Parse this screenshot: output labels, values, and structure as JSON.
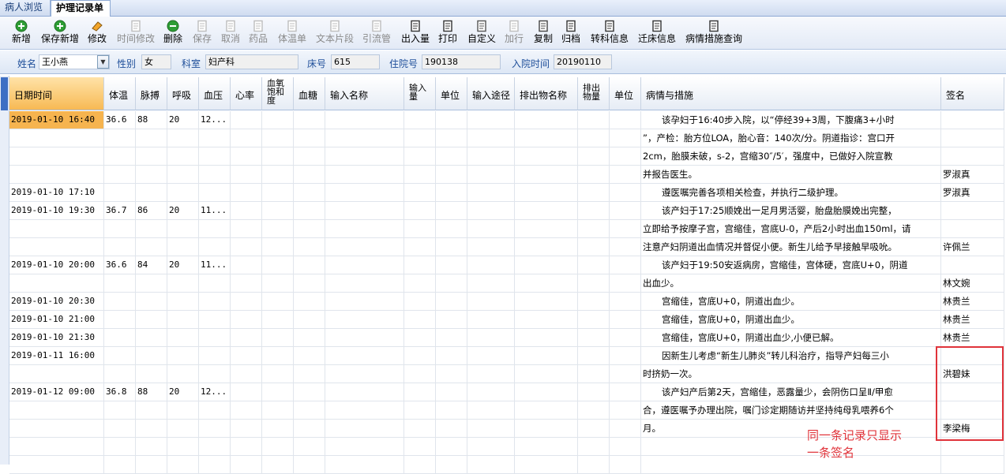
{
  "tabs": [
    "病人浏览",
    "护理记录单"
  ],
  "toolbar": [
    {
      "label": "新增",
      "icon": "add-green-icon",
      "enabled": true
    },
    {
      "label": "保存新增",
      "icon": "save-add-green-icon",
      "enabled": true
    },
    {
      "label": "修改",
      "icon": "eraser-icon",
      "enabled": true
    },
    {
      "label": "时间修改",
      "icon": "clock-edit-icon",
      "enabled": false
    },
    {
      "label": "删除",
      "icon": "delete-green-icon",
      "enabled": true
    },
    {
      "label": "保存",
      "icon": "save-disk-icon",
      "enabled": false
    },
    {
      "label": "取消",
      "icon": "undo-icon",
      "enabled": false
    },
    {
      "label": "药品",
      "icon": "medicine-icon",
      "enabled": false
    },
    {
      "label": "体温单",
      "icon": "temperature-sheet-icon",
      "enabled": false
    },
    {
      "label": "文本片段",
      "icon": "text-snippet-icon",
      "enabled": false
    },
    {
      "label": "引流管",
      "icon": "drain-tube-icon",
      "enabled": false
    },
    {
      "label": "出入量",
      "icon": "io-volume-icon",
      "enabled": true
    },
    {
      "label": "打印",
      "icon": "printer-icon",
      "enabled": true
    },
    {
      "label": "自定义",
      "icon": "custom-doc-icon",
      "enabled": true
    },
    {
      "label": "加行",
      "icon": "add-row-icon",
      "enabled": false
    },
    {
      "label": "复制",
      "icon": "copy-icon",
      "enabled": true
    },
    {
      "label": "归档",
      "icon": "archive-icon",
      "enabled": true
    },
    {
      "label": "转科信息",
      "icon": "transfer-dept-icon",
      "enabled": true
    },
    {
      "label": "迁床信息",
      "icon": "move-bed-icon",
      "enabled": true
    },
    {
      "label": "病情措施查询",
      "icon": "query-icon",
      "enabled": true
    }
  ],
  "patient": {
    "name_label": "姓名",
    "name": "王小燕",
    "gender_label": "性别",
    "gender": "女",
    "dept_label": "科室",
    "dept": "妇产科",
    "bed_label": "床号",
    "bed": "615",
    "admission_no_label": "住院号",
    "admission_no": "190138",
    "admit_time_label": "入院时间",
    "admit_time": "20190110"
  },
  "table": {
    "headers": [
      "日期时间",
      "体温",
      "脉搏",
      "呼吸",
      "血压",
      "心率",
      "血氧饱和度",
      "血糖",
      "输入名称",
      "输入量",
      "单位",
      "输入途径",
      "排出物名称",
      "排出物量",
      "单位",
      "病情与措施",
      "签名"
    ],
    "rows": [
      {
        "datetime": "2019-01-10 16:40",
        "temp": "36.6",
        "pulse": "88",
        "resp": "20",
        "bp": "12...",
        "condition": "该孕妇于16:40步入院，以“停经39+3周，下腹痛3+小时",
        "sign": ""
      },
      {
        "datetime": "",
        "temp": "",
        "pulse": "",
        "resp": "",
        "bp": "",
        "condition": "”，产检：胎方位LOA，胎心音：140次/分。阴道指诊：宫口开",
        "sign": ""
      },
      {
        "datetime": "",
        "temp": "",
        "pulse": "",
        "resp": "",
        "bp": "",
        "condition": "2cm，胎膜未破，s-2，宫缩30″/5′，强度中，已做好入院宣教",
        "sign": ""
      },
      {
        "datetime": "",
        "temp": "",
        "pulse": "",
        "resp": "",
        "bp": "",
        "condition": "并报告医生。",
        "sign": "罗淑真"
      },
      {
        "datetime": "2019-01-10 17:10",
        "temp": "",
        "pulse": "",
        "resp": "",
        "bp": "",
        "condition": "遵医嘱完善各项相关检查，并执行二级护理。",
        "sign": "罗淑真"
      },
      {
        "datetime": "2019-01-10 19:30",
        "temp": "36.7",
        "pulse": "86",
        "resp": "20",
        "bp": "11...",
        "condition": "该产妇于17:25顺娩出一足月男活婴，胎盘胎膜娩出完整，",
        "sign": ""
      },
      {
        "datetime": "",
        "temp": "",
        "pulse": "",
        "resp": "",
        "bp": "",
        "condition": "立即给予按摩子宫，宫缩佳，宫底U-0，产后2小时出血150ml，请",
        "sign": ""
      },
      {
        "datetime": "",
        "temp": "",
        "pulse": "",
        "resp": "",
        "bp": "",
        "condition": "注意产妇阴道出血情况并督促小便。新生儿给予早接触早吸吮。",
        "sign": "许佩兰"
      },
      {
        "datetime": "2019-01-10 20:00",
        "temp": "36.6",
        "pulse": "84",
        "resp": "20",
        "bp": "11...",
        "condition": "该产妇于19:50安返病房，宫缩佳，宫体硬，宫底U+0，阴道",
        "sign": ""
      },
      {
        "datetime": "",
        "temp": "",
        "pulse": "",
        "resp": "",
        "bp": "",
        "condition": "出血少。",
        "sign": "林文婉"
      },
      {
        "datetime": "2019-01-10 20:30",
        "temp": "",
        "pulse": "",
        "resp": "",
        "bp": "",
        "condition": "宫缩佳，宫底U+0，阴道出血少。",
        "sign": "林贵兰"
      },
      {
        "datetime": "2019-01-10 21:00",
        "temp": "",
        "pulse": "",
        "resp": "",
        "bp": "",
        "condition": "宫缩佳，宫底U+0，阴道出血少。",
        "sign": "林贵兰"
      },
      {
        "datetime": "2019-01-10 21:30",
        "temp": "",
        "pulse": "",
        "resp": "",
        "bp": "",
        "condition": "宫缩佳，宫底U+0，阴道出血少,小便已解。",
        "sign": "林贵兰"
      },
      {
        "datetime": "2019-01-11 16:00",
        "temp": "",
        "pulse": "",
        "resp": "",
        "bp": "",
        "condition": "因新生儿考虑“新生儿肺炎”转儿科治疗，指导产妇每三小",
        "sign": ""
      },
      {
        "datetime": "",
        "temp": "",
        "pulse": "",
        "resp": "",
        "bp": "",
        "condition": "时挤奶一次。",
        "sign": "洪碧妹"
      },
      {
        "datetime": "2019-01-12 09:00",
        "temp": "36.8",
        "pulse": "88",
        "resp": "20",
        "bp": "12...",
        "condition": "该产妇产后第2天，宫缩佳，恶露量少，会阴伤口呈Ⅱ/甲愈",
        "sign": ""
      },
      {
        "datetime": "",
        "temp": "",
        "pulse": "",
        "resp": "",
        "bp": "",
        "condition": "合，遵医嘱予办理出院，嘱门诊定期随访并坚持纯母乳喂养6个",
        "sign": ""
      },
      {
        "datetime": "",
        "temp": "",
        "pulse": "",
        "resp": "",
        "bp": "",
        "condition": "月。",
        "sign": "李梁梅"
      },
      {
        "datetime": "",
        "temp": "",
        "pulse": "",
        "resp": "",
        "bp": "",
        "condition": "",
        "sign": ""
      },
      {
        "datetime": "",
        "temp": "",
        "pulse": "",
        "resp": "",
        "bp": "",
        "condition": "",
        "sign": ""
      }
    ]
  },
  "annotation": {
    "line1": "同一条记录只显示",
    "line2": "一条签名",
    "color": "#e0333a"
  }
}
